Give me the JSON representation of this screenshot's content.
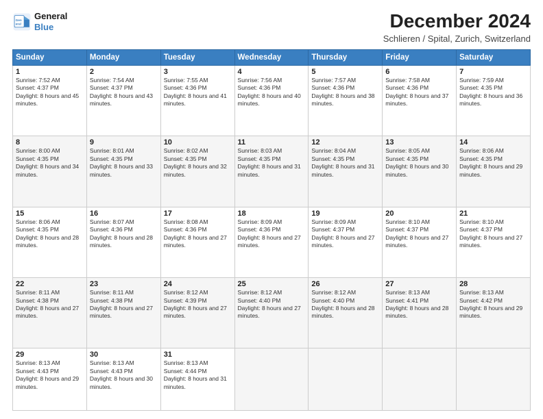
{
  "logo": {
    "line1": "General",
    "line2": "Blue"
  },
  "title": "December 2024",
  "subtitle": "Schlieren / Spital, Zurich, Switzerland",
  "weekdays": [
    "Sunday",
    "Monday",
    "Tuesday",
    "Wednesday",
    "Thursday",
    "Friday",
    "Saturday"
  ],
  "weeks": [
    [
      {
        "day": 1,
        "sunrise": "7:52 AM",
        "sunset": "4:37 PM",
        "daylight": "8 hours and 45 minutes."
      },
      {
        "day": 2,
        "sunrise": "7:54 AM",
        "sunset": "4:37 PM",
        "daylight": "8 hours and 43 minutes."
      },
      {
        "day": 3,
        "sunrise": "7:55 AM",
        "sunset": "4:36 PM",
        "daylight": "8 hours and 41 minutes."
      },
      {
        "day": 4,
        "sunrise": "7:56 AM",
        "sunset": "4:36 PM",
        "daylight": "8 hours and 40 minutes."
      },
      {
        "day": 5,
        "sunrise": "7:57 AM",
        "sunset": "4:36 PM",
        "daylight": "8 hours and 38 minutes."
      },
      {
        "day": 6,
        "sunrise": "7:58 AM",
        "sunset": "4:36 PM",
        "daylight": "8 hours and 37 minutes."
      },
      {
        "day": 7,
        "sunrise": "7:59 AM",
        "sunset": "4:35 PM",
        "daylight": "8 hours and 36 minutes."
      }
    ],
    [
      {
        "day": 8,
        "sunrise": "8:00 AM",
        "sunset": "4:35 PM",
        "daylight": "8 hours and 34 minutes."
      },
      {
        "day": 9,
        "sunrise": "8:01 AM",
        "sunset": "4:35 PM",
        "daylight": "8 hours and 33 minutes."
      },
      {
        "day": 10,
        "sunrise": "8:02 AM",
        "sunset": "4:35 PM",
        "daylight": "8 hours and 32 minutes."
      },
      {
        "day": 11,
        "sunrise": "8:03 AM",
        "sunset": "4:35 PM",
        "daylight": "8 hours and 31 minutes."
      },
      {
        "day": 12,
        "sunrise": "8:04 AM",
        "sunset": "4:35 PM",
        "daylight": "8 hours and 31 minutes."
      },
      {
        "day": 13,
        "sunrise": "8:05 AM",
        "sunset": "4:35 PM",
        "daylight": "8 hours and 30 minutes."
      },
      {
        "day": 14,
        "sunrise": "8:06 AM",
        "sunset": "4:35 PM",
        "daylight": "8 hours and 29 minutes."
      }
    ],
    [
      {
        "day": 15,
        "sunrise": "8:06 AM",
        "sunset": "4:35 PM",
        "daylight": "8 hours and 28 minutes."
      },
      {
        "day": 16,
        "sunrise": "8:07 AM",
        "sunset": "4:36 PM",
        "daylight": "8 hours and 28 minutes."
      },
      {
        "day": 17,
        "sunrise": "8:08 AM",
        "sunset": "4:36 PM",
        "daylight": "8 hours and 27 minutes."
      },
      {
        "day": 18,
        "sunrise": "8:09 AM",
        "sunset": "4:36 PM",
        "daylight": "8 hours and 27 minutes."
      },
      {
        "day": 19,
        "sunrise": "8:09 AM",
        "sunset": "4:37 PM",
        "daylight": "8 hours and 27 minutes."
      },
      {
        "day": 20,
        "sunrise": "8:10 AM",
        "sunset": "4:37 PM",
        "daylight": "8 hours and 27 minutes."
      },
      {
        "day": 21,
        "sunrise": "8:10 AM",
        "sunset": "4:37 PM",
        "daylight": "8 hours and 27 minutes."
      }
    ],
    [
      {
        "day": 22,
        "sunrise": "8:11 AM",
        "sunset": "4:38 PM",
        "daylight": "8 hours and 27 minutes."
      },
      {
        "day": 23,
        "sunrise": "8:11 AM",
        "sunset": "4:38 PM",
        "daylight": "8 hours and 27 minutes."
      },
      {
        "day": 24,
        "sunrise": "8:12 AM",
        "sunset": "4:39 PM",
        "daylight": "8 hours and 27 minutes."
      },
      {
        "day": 25,
        "sunrise": "8:12 AM",
        "sunset": "4:40 PM",
        "daylight": "8 hours and 27 minutes."
      },
      {
        "day": 26,
        "sunrise": "8:12 AM",
        "sunset": "4:40 PM",
        "daylight": "8 hours and 28 minutes."
      },
      {
        "day": 27,
        "sunrise": "8:13 AM",
        "sunset": "4:41 PM",
        "daylight": "8 hours and 28 minutes."
      },
      {
        "day": 28,
        "sunrise": "8:13 AM",
        "sunset": "4:42 PM",
        "daylight": "8 hours and 29 minutes."
      }
    ],
    [
      {
        "day": 29,
        "sunrise": "8:13 AM",
        "sunset": "4:43 PM",
        "daylight": "8 hours and 29 minutes."
      },
      {
        "day": 30,
        "sunrise": "8:13 AM",
        "sunset": "4:43 PM",
        "daylight": "8 hours and 30 minutes."
      },
      {
        "day": 31,
        "sunrise": "8:13 AM",
        "sunset": "4:44 PM",
        "daylight": "8 hours and 31 minutes."
      },
      null,
      null,
      null,
      null
    ]
  ]
}
